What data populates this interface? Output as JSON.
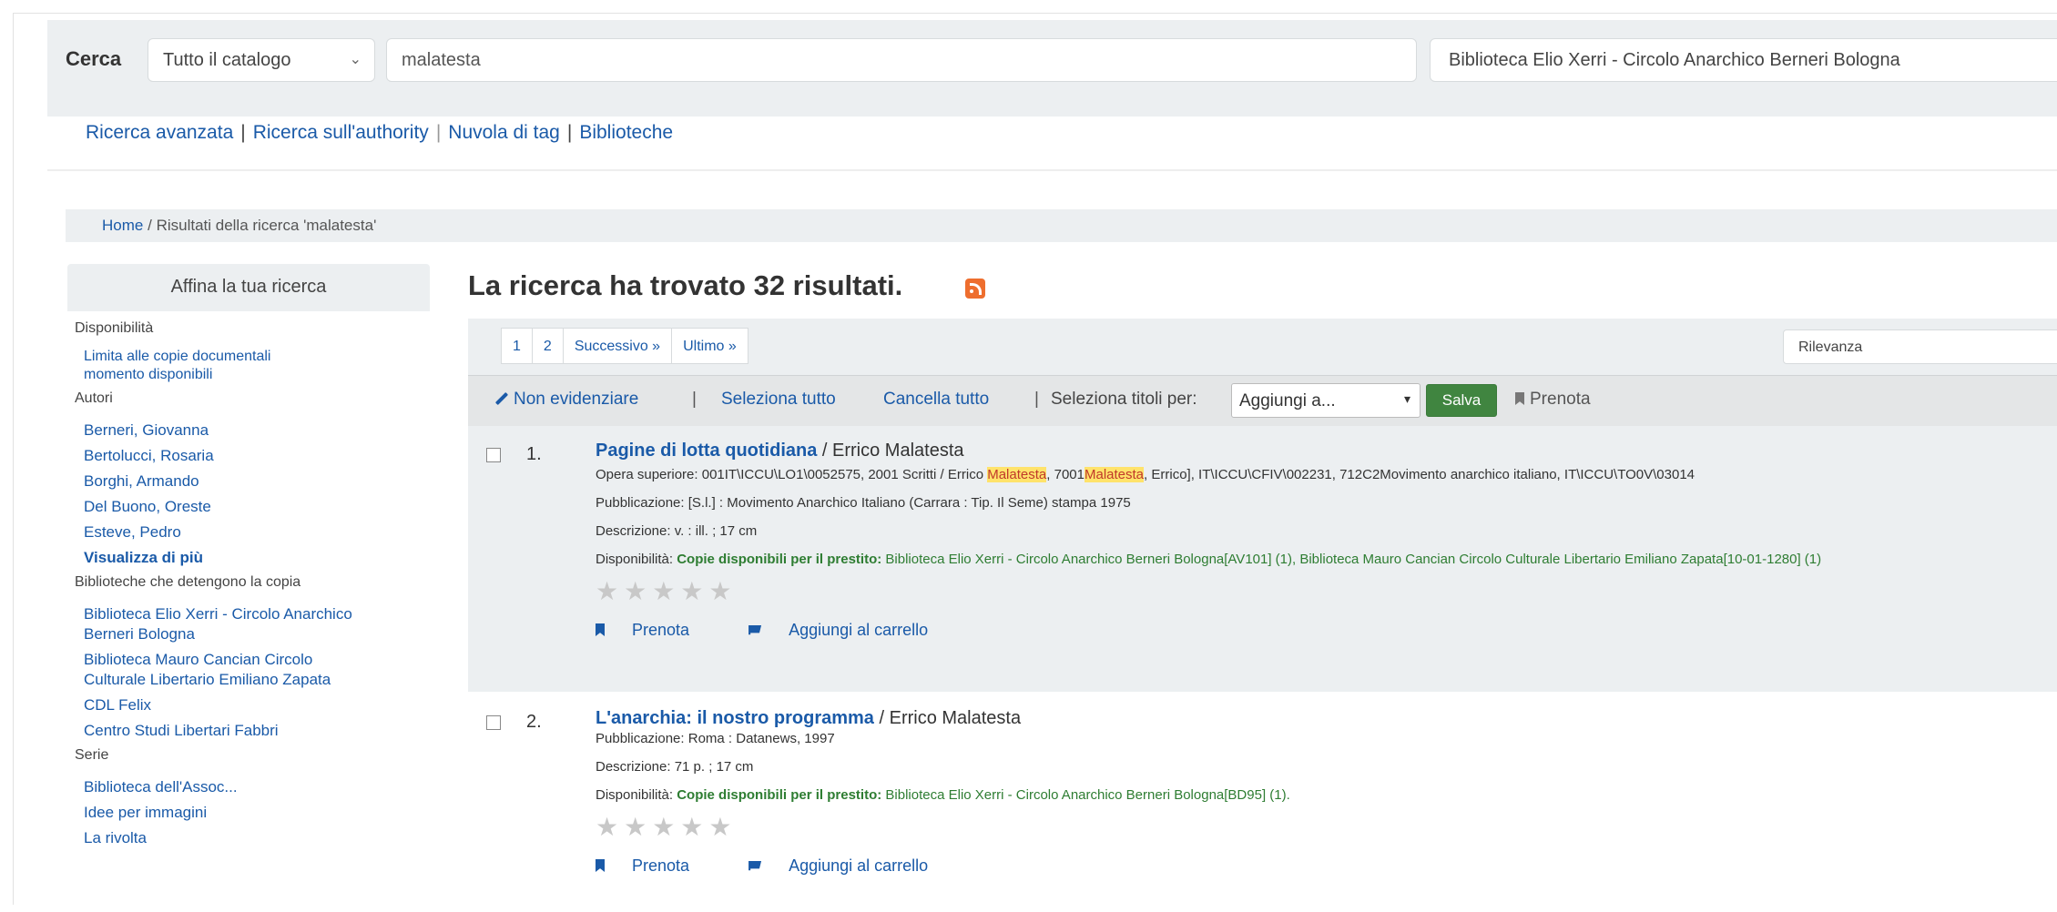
{
  "search": {
    "label": "Cerca",
    "scope": "Tutto il catalogo",
    "query": "malatesta",
    "library": "Biblioteca Elio Xerri - Circolo Anarchico Berneri Bologna"
  },
  "moresearches": {
    "advanced": "Ricerca avanzata",
    "authority": "Ricerca sull'authority",
    "tags": "Nuvola di tag",
    "libraries": "Biblioteche"
  },
  "breadcrumb": {
    "home": "Home",
    "sep": "/",
    "current": "Risultati della ricerca 'malatesta'"
  },
  "facets": {
    "heading": "Affina la tua ricerca",
    "availability": {
      "title": "Disponibilità",
      "items": [
        "Limita alle copie documentali",
        "momento disponibili"
      ]
    },
    "authors": {
      "title": "Autori",
      "items": [
        "Berneri, Giovanna",
        "Bertolucci, Rosaria",
        "Borghi, Armando",
        "Del Buono, Oreste",
        "Esteve, Pedro"
      ],
      "more": "Visualizza di più"
    },
    "holding": {
      "title": "Biblioteche che detengono la copia",
      "items": [
        [
          "Biblioteca Elio Xerri - Circolo Anarchico",
          "Berneri Bologna"
        ],
        [
          "Biblioteca Mauro Cancian Circolo",
          "Culturale Libertario Emiliano Zapata"
        ],
        [
          "CDL Felix"
        ],
        [
          "Centro Studi Libertari Fabbri"
        ]
      ]
    },
    "series": {
      "title": "Serie",
      "items": [
        "Biblioteca dell'Assoc...",
        "Idee per immagini",
        "La rivolta"
      ]
    }
  },
  "results": {
    "title": "La ricerca ha trovato 32 risultati.",
    "pager": [
      "1",
      "2",
      "Successivo »",
      "Ultimo »"
    ],
    "sort": "Rilevanza",
    "toolbar": {
      "no_highlight": "Non evidenziare",
      "select_all": "Seleziona tutto",
      "clear_all": "Cancella tutto",
      "select_label": "Seleziona titoli per:",
      "add_to": "Aggiungi a...",
      "save": "Salva",
      "hold": "Prenota"
    },
    "items": [
      {
        "num": "1.",
        "title": "Pagine di lotta quotidiana",
        "author": " / Errico Malatesta",
        "series_label": "Opera superiore: ",
        "series_a": "001IT\\ICCU\\LO1\\0052575, 2001 Scritti / Errico ",
        "series_hl1": "Malatesta",
        "series_b": ", 7001",
        "series_hl2": "Malatesta",
        "series_c": ", Errico], IT\\ICCU\\CFIV\\002231, 712C2Movimento anarchico italiano, IT\\ICCU\\TO0V\\03014",
        "pub_label": "Pubblicazione: ",
        "pub": "[S.l.] : Movimento Anarchico Italiano (Carrara : Tip. Il Seme) stampa 1975",
        "desc_label": "Descrizione: ",
        "desc": "v. : ill. ; 17 cm",
        "avail_label": "Disponibilità: ",
        "avail_strong": "Copie disponibili per il prestito: ",
        "avail_text": "Biblioteca Elio Xerri - Circolo Anarchico Berneri Bologna[AV101] (1), Biblioteca Mauro Cancian Circolo Culturale Libertario Emiliano Zapata[10-01-1280] (1)",
        "stars": "★★★★★",
        "hold": "Prenota",
        "cart": "Aggiungi al carrello"
      },
      {
        "num": "2.",
        "title": "L'anarchia: il nostro programma",
        "author": " / Errico Malatesta",
        "pub_label": "Pubblicazione: ",
        "pub": "Roma : Datanews, 1997",
        "desc_label": "Descrizione: ",
        "desc": "71 p. ; 17 cm",
        "avail_label": "Disponibilità: ",
        "avail_strong": "Copie disponibili per il prestito: ",
        "avail_text": "Biblioteca Elio Xerri - Circolo Anarchico Berneri Bologna[BD95] (1).",
        "stars": "★★★★★",
        "hold": "Prenota",
        "cart": "Aggiungi al carrello"
      }
    ]
  }
}
